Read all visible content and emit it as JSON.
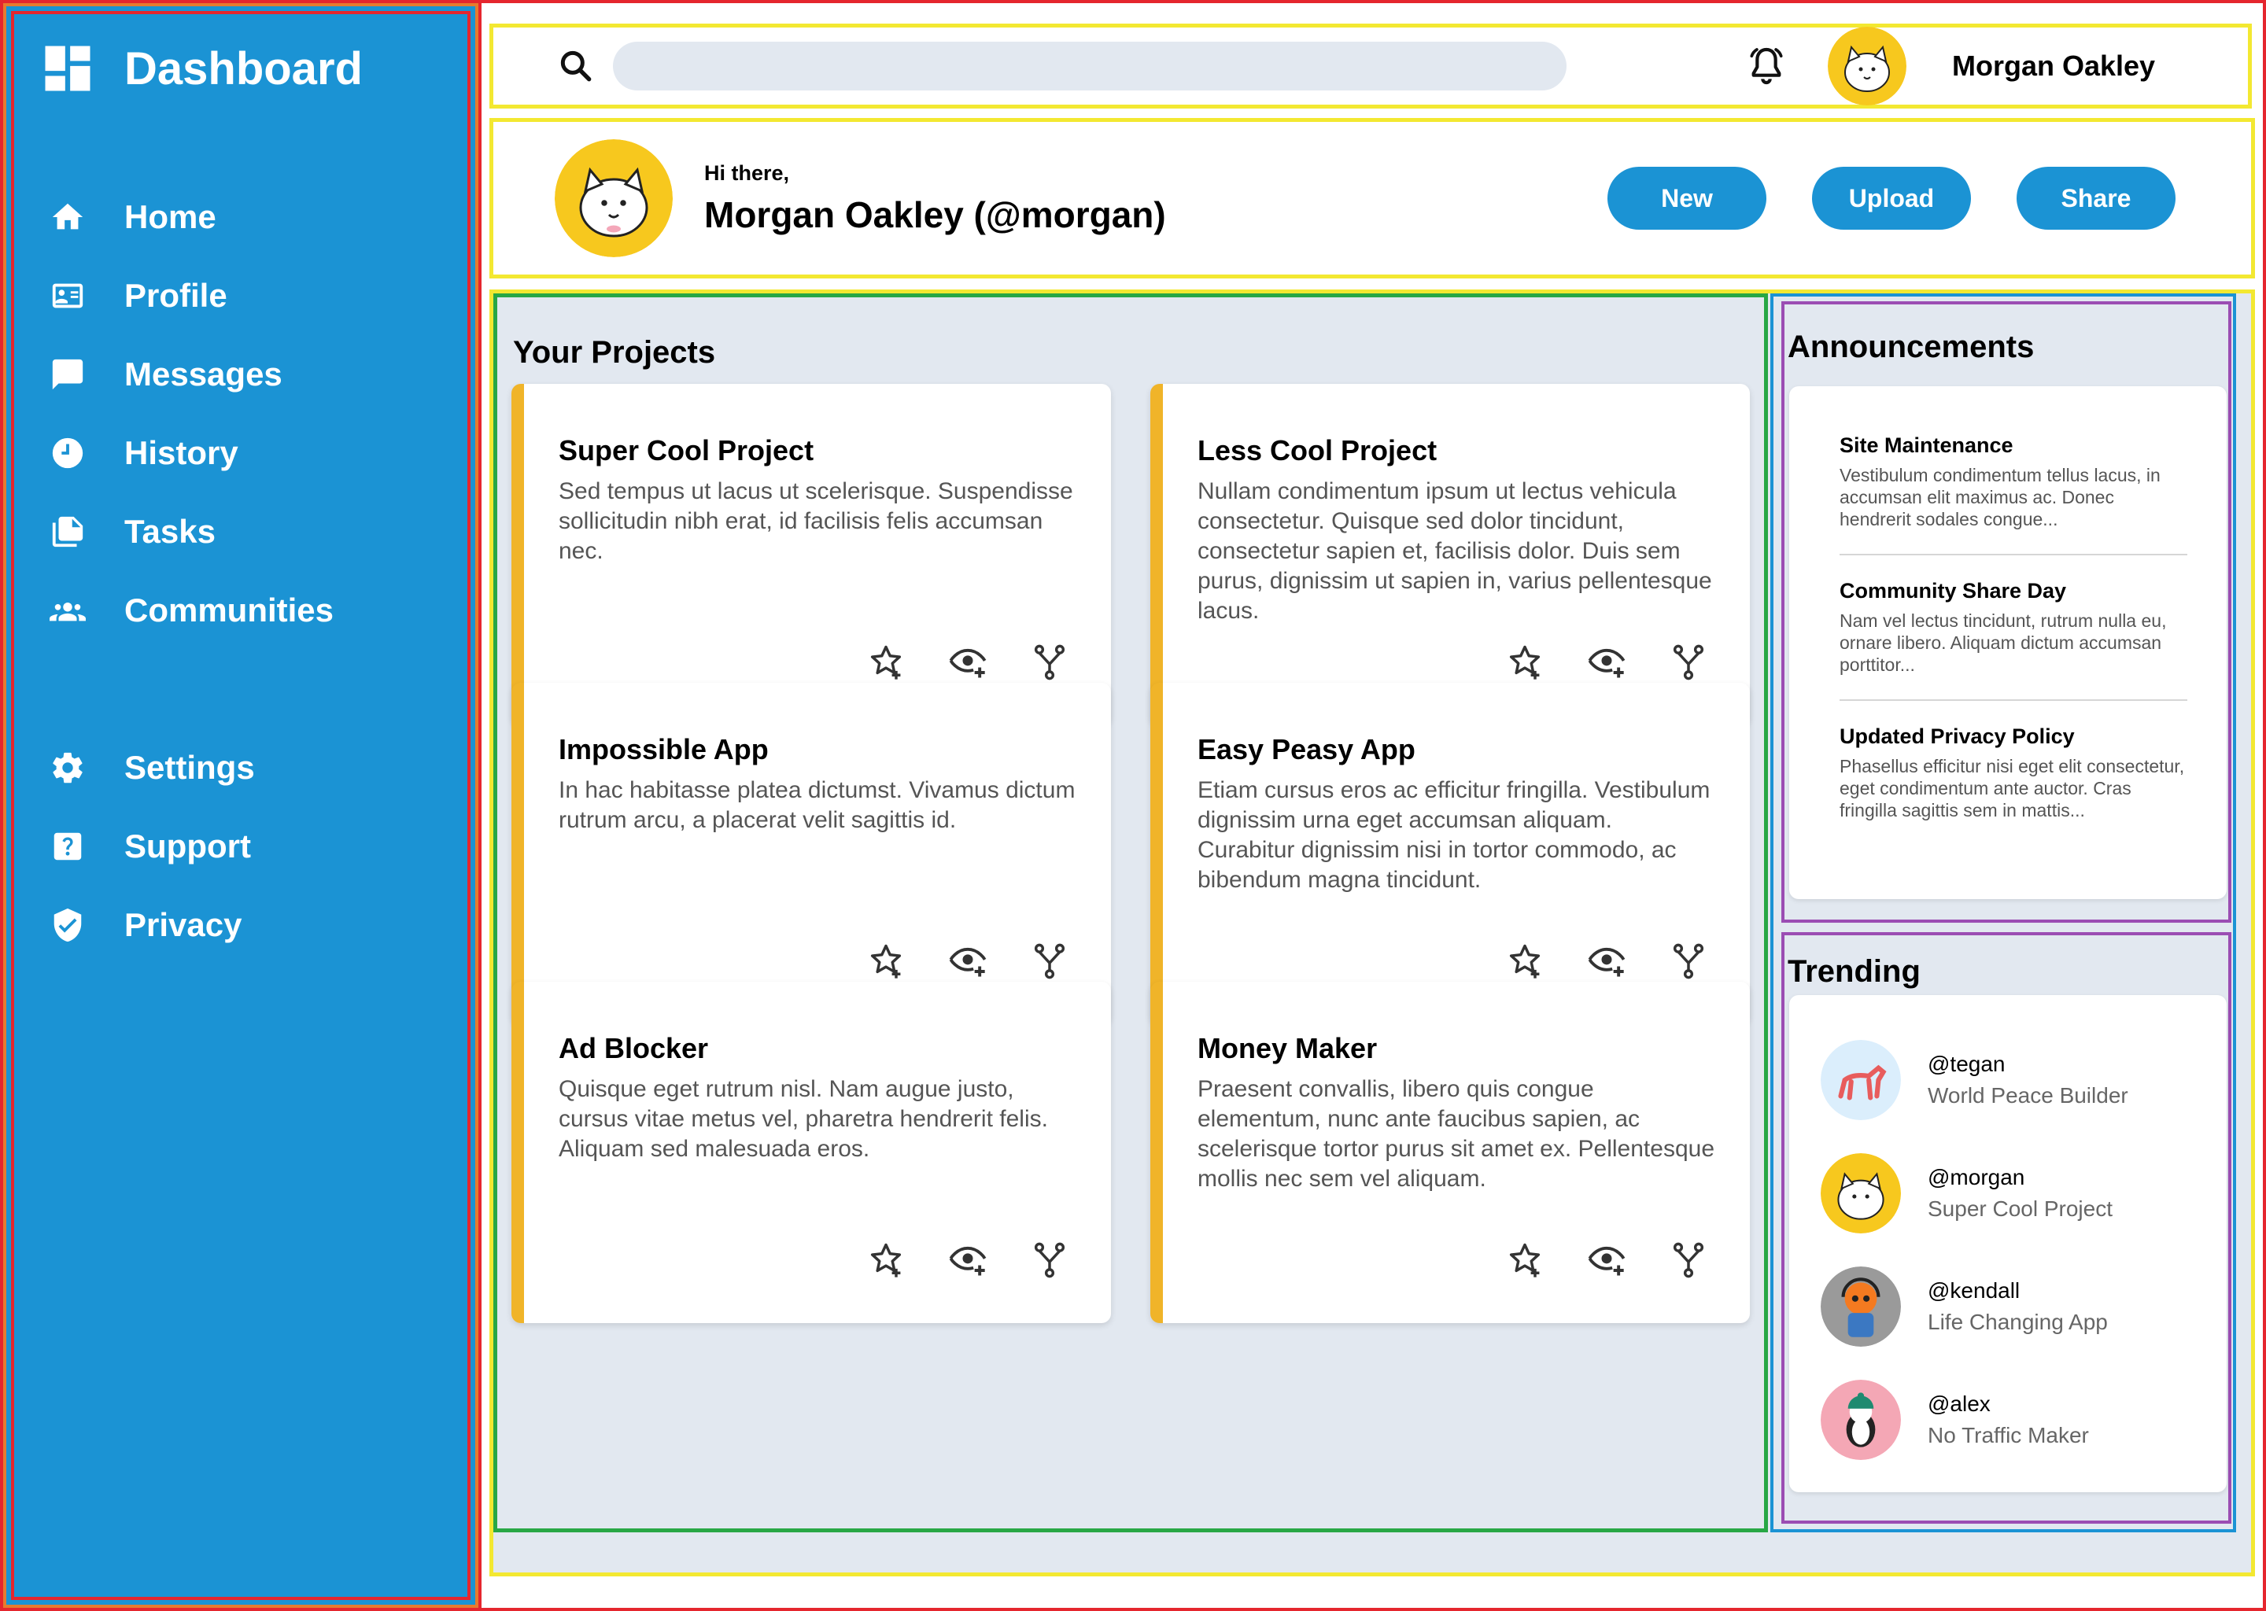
{
  "sidebar": {
    "brand": "Dashboard",
    "primary": [
      {
        "label": "Home",
        "icon": "home-icon"
      },
      {
        "label": "Profile",
        "icon": "profile-card-icon"
      },
      {
        "label": "Messages",
        "icon": "message-icon"
      },
      {
        "label": "History",
        "icon": "clock-icon"
      },
      {
        "label": "Tasks",
        "icon": "document-icon"
      },
      {
        "label": "Communities",
        "icon": "people-icon"
      }
    ],
    "secondary": [
      {
        "label": "Settings",
        "icon": "gear-icon"
      },
      {
        "label": "Support",
        "icon": "help-icon"
      },
      {
        "label": "Privacy",
        "icon": "shield-icon"
      }
    ]
  },
  "topbar": {
    "search_placeholder": "",
    "username": "Morgan Oakley"
  },
  "hero": {
    "greeting": "Hi there,",
    "name": "Morgan Oakley (@morgan)",
    "actions": [
      "New",
      "Upload",
      "Share"
    ]
  },
  "projects": {
    "title": "Your Projects",
    "items": [
      {
        "title": "Super Cool Project",
        "desc": "Sed tempus ut lacus ut scelerisque. Suspendisse sollicitudin nibh erat, id facilisis felis accumsan nec."
      },
      {
        "title": "Less Cool Project",
        "desc": "Nullam condimentum ipsum ut lectus vehicula consectetur. Quisque sed dolor tincidunt, consectetur sapien et, facilisis dolor. Duis sem purus, dignissim ut sapien in, varius pellentesque lacus."
      },
      {
        "title": "Impossible App",
        "desc": "In hac habitasse platea dictumst. Vivamus dictum rutrum arcu, a placerat velit sagittis id."
      },
      {
        "title": "Easy Peasy App",
        "desc": "Etiam cursus eros ac efficitur fringilla. Vestibulum dignissim urna eget accumsan aliquam. Curabitur dignissim nisi in tortor commodo, ac bibendum magna tincidunt."
      },
      {
        "title": "Ad Blocker",
        "desc": "Quisque eget rutrum nisl. Nam augue justo, cursus vitae metus vel, pharetra hendrerit felis. Aliquam sed malesuada eros."
      },
      {
        "title": "Money Maker",
        "desc": "Praesent convallis, libero quis congue elementum, nunc ante faucibus sapien, ac scelerisque tortor purus sit amet ex. Pellentesque mollis nec sem vel aliquam."
      }
    ]
  },
  "announcements": {
    "title": "Announcements",
    "items": [
      {
        "title": "Site Maintenance",
        "text": "Vestibulum condimentum tellus lacus, in accumsan elit maximus ac. Donec hendrerit sodales congue..."
      },
      {
        "title": "Community Share Day",
        "text": "Nam vel lectus tincidunt, rutrum nulla eu, ornare libero. Aliquam dictum accumsan porttitor..."
      },
      {
        "title": "Updated Privacy Policy",
        "text": "Phasellus efficitur nisi eget elit consectetur, eget condimentum ante auctor. Cras fringilla sagittis sem in mattis..."
      }
    ]
  },
  "trending": {
    "title": "Trending",
    "items": [
      {
        "handle": "@tegan",
        "sub": "World Peace Builder"
      },
      {
        "handle": "@morgan",
        "sub": "Super Cool Project"
      },
      {
        "handle": "@kendall",
        "sub": "Life Changing App"
      },
      {
        "handle": "@alex",
        "sub": "No Traffic Maker"
      }
    ]
  },
  "colors": {
    "sidebar": "#1b93d4",
    "accent": "#f0b429",
    "content_bg": "#e2e8f0",
    "avatar_yellow": "#f7c81e"
  }
}
